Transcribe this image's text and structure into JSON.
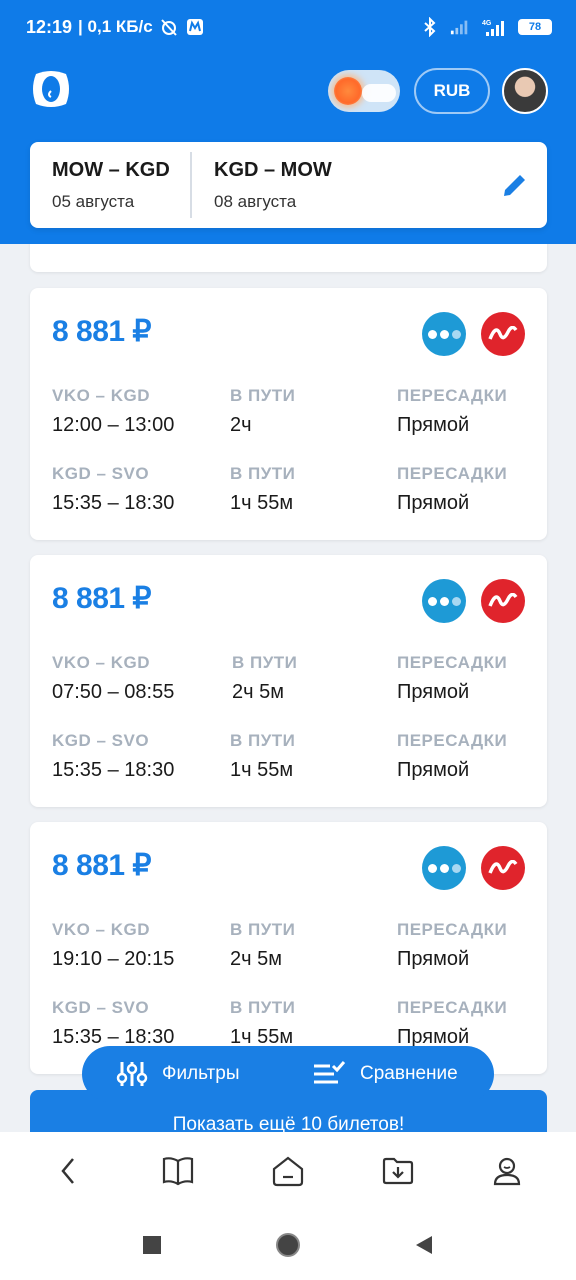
{
  "status_bar": {
    "time": "12:19",
    "net_speed": "| 0,1 КБ/с",
    "battery": "78",
    "icons": [
      "alarm-off-icon",
      "app-notification-icon",
      "bluetooth-icon",
      "signal-icon",
      "signal-4g-icon",
      "battery-icon"
    ]
  },
  "header": {
    "currency": "RUB",
    "route": {
      "out": {
        "title": "MOW – KGD",
        "date": "05 августа"
      },
      "back": {
        "title": "KGD – MOW",
        "date": "08 августа"
      }
    }
  },
  "tickets": [
    {
      "price": "8 881 ₽",
      "segments": [
        {
          "route": "VKO – KGD",
          "time": "12:00 – 13:00",
          "duration_label": "В ПУТИ",
          "duration": "2ч",
          "stops_label": "ПЕРЕСАДКИ",
          "stops": "Прямой"
        },
        {
          "route": "KGD – SVO",
          "time": "15:35 – 18:30",
          "duration_label": "В ПУТИ",
          "duration": "1ч 55м",
          "stops_label": "ПЕРЕСАДКИ",
          "stops": "Прямой"
        }
      ]
    },
    {
      "price": "8 881 ₽",
      "segments": [
        {
          "route": "VKO – KGD",
          "time": "07:50 – 08:55",
          "duration_label": "В ПУТИ",
          "duration": "2ч 5м",
          "stops_label": "ПЕРЕСАДКИ",
          "stops": "Прямой"
        },
        {
          "route": "KGD – SVO",
          "time": "15:35 – 18:30",
          "duration_label": "В ПУТИ",
          "duration": "1ч 55м",
          "stops_label": "ПЕРЕСАДКИ",
          "stops": "Прямой"
        }
      ]
    },
    {
      "price": "8 881 ₽",
      "segments": [
        {
          "route": "VKO – KGD",
          "time": "19:10 – 20:15",
          "duration_label": "В ПУТИ",
          "duration": "2ч 5м",
          "stops_label": "ПЕРЕСАДКИ",
          "stops": "Прямой"
        },
        {
          "route": "KGD – SVO",
          "time": "15:35 – 18:30",
          "duration_label": "В ПУТИ",
          "duration": "1ч 55м",
          "stops_label": "ПЕРЕСАДКИ",
          "stops": "Прямой"
        }
      ]
    }
  ],
  "floating_bar": {
    "filters_label": "Фильтры",
    "compare_label": "Сравнение"
  },
  "more_button": "Показать ещё 10 билетов!",
  "colors": {
    "brand_blue": "#0f7be8",
    "price_blue": "#1a7fe4",
    "airline_blue": "#1e9ad6",
    "airline_red": "#e0242c",
    "label_gray": "#a7b1bd"
  }
}
